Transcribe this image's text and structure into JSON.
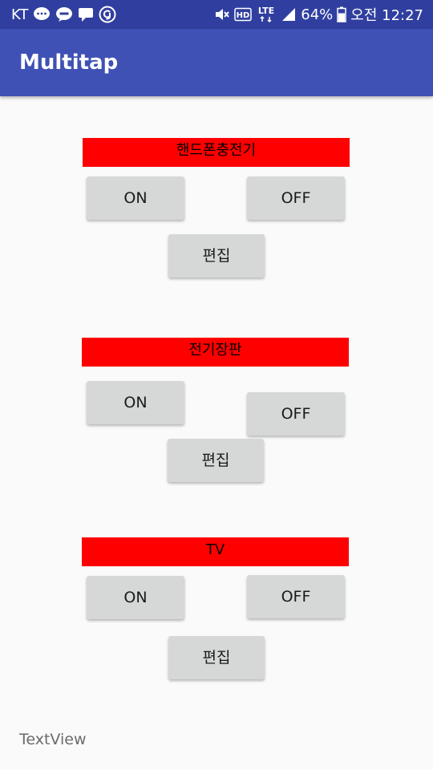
{
  "status_bar": {
    "carrier": "KT",
    "left_icons": [
      "chat-bubble-icon",
      "kakaotalk-icon",
      "message-icon",
      "g-icon"
    ],
    "right_icons": [
      "mute-icon",
      "hd-icon",
      "lte-icon",
      "signal-icon",
      "battery-icon"
    ],
    "hd_label": "HD",
    "lte_label": "LTE",
    "battery": "64%",
    "time": "오전 12:27"
  },
  "app_bar": {
    "title": "Multitap",
    "color": "#3f51b5"
  },
  "devices": [
    {
      "label": "핸드폰충전기",
      "on_label": "ON",
      "off_label": "OFF",
      "edit_label": "편집"
    },
    {
      "label": "전기장판",
      "on_label": "ON",
      "off_label": "OFF",
      "edit_label": "편집"
    },
    {
      "label": "TV",
      "on_label": "ON",
      "off_label": "OFF",
      "edit_label": "편집"
    }
  ],
  "label_color": "#ff0000",
  "textview": "TextView"
}
